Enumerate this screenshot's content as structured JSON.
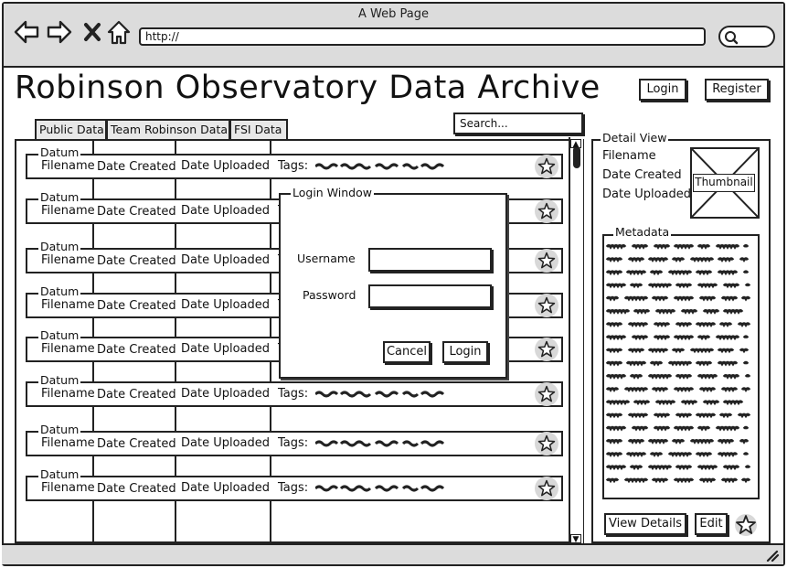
{
  "browser": {
    "window_title": "A Web Page",
    "url": "http://",
    "nav_icons": [
      "back-arrow-icon",
      "forward-arrow-icon",
      "close-icon",
      "home-icon"
    ],
    "search_icon": "search-icon"
  },
  "header": {
    "title": "Robinson Observatory Data Archive",
    "login_label": "Login",
    "register_label": "Register"
  },
  "tabs": [
    {
      "label": "Public Data"
    },
    {
      "label": "Team Robinson Data"
    },
    {
      "label": "FSI Data"
    }
  ],
  "search": {
    "placeholder": "Search..."
  },
  "list": {
    "datum_label": "Datum",
    "filename_label": "Filename",
    "date_created_label": "Date Created",
    "date_uploaded_label": "Date Uploaded",
    "tags_label": "Tags:",
    "row_count": 8
  },
  "login_window": {
    "title": "Login Window",
    "username_label": "Username",
    "password_label": "Password",
    "cancel_label": "Cancel",
    "login_label": "Login"
  },
  "detail_view": {
    "title": "Detail View",
    "filename_label": "Filename",
    "date_created_label": "Date Created",
    "date_uploaded_label": "Date Uploaded",
    "thumbnail_label": "Thumbnail",
    "metadata_title": "Metadata",
    "view_details_label": "View Details",
    "edit_label": "Edit"
  }
}
